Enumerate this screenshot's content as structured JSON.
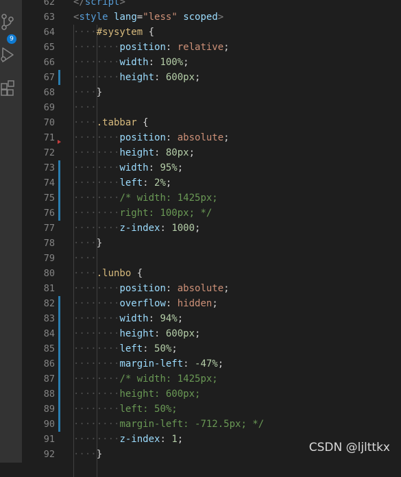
{
  "activity_bar": {
    "icons": [
      "source-control-icon",
      "run-debug-icon",
      "extensions-icon"
    ],
    "scm_badge": "9",
    "accent_color": "#0e7ad1"
  },
  "editor": {
    "lines": [
      {
        "num": "62",
        "indent": 0,
        "tokens": [
          {
            "t": "</",
            "c": "tag"
          },
          {
            "t": "script",
            "c": "tagname"
          },
          {
            "t": ">",
            "c": "tag"
          }
        ]
      },
      {
        "num": "63",
        "indent": 0,
        "tokens": [
          {
            "t": "<",
            "c": "tag"
          },
          {
            "t": "style",
            "c": "tagname"
          },
          {
            "t": " ",
            "c": "punc"
          },
          {
            "t": "lang",
            "c": "attr"
          },
          {
            "t": "=",
            "c": "punc"
          },
          {
            "t": "\"less\"",
            "c": "str"
          },
          {
            "t": " ",
            "c": "punc"
          },
          {
            "t": "scoped",
            "c": "attr"
          },
          {
            "t": ">",
            "c": "tag"
          }
        ]
      },
      {
        "num": "64",
        "indent": 4,
        "tokens": [
          {
            "t": "#sysytem",
            "c": "sel"
          },
          {
            "t": " {",
            "c": "punc"
          }
        ]
      },
      {
        "num": "65",
        "indent": 8,
        "tokens": [
          {
            "t": "position",
            "c": "prop"
          },
          {
            "t": ": ",
            "c": "punc"
          },
          {
            "t": "relative",
            "c": "val"
          },
          {
            "t": ";",
            "c": "punc"
          }
        ]
      },
      {
        "num": "66",
        "indent": 8,
        "tokens": [
          {
            "t": "width",
            "c": "prop"
          },
          {
            "t": ": ",
            "c": "punc"
          },
          {
            "t": "100%",
            "c": "num"
          },
          {
            "t": ";",
            "c": "punc"
          }
        ]
      },
      {
        "num": "67",
        "indent": 8,
        "tokens": [
          {
            "t": "height",
            "c": "prop"
          },
          {
            "t": ": ",
            "c": "punc"
          },
          {
            "t": "600px",
            "c": "num"
          },
          {
            "t": ";",
            "c": "punc"
          }
        ]
      },
      {
        "num": "68",
        "indent": 4,
        "tokens": [
          {
            "t": "}",
            "c": "punc"
          }
        ]
      },
      {
        "num": "69",
        "indent": 4,
        "tokens": []
      },
      {
        "num": "70",
        "indent": 4,
        "tokens": [
          {
            "t": ".tabbar",
            "c": "sel"
          },
          {
            "t": " {",
            "c": "punc"
          }
        ]
      },
      {
        "num": "71",
        "indent": 8,
        "tokens": [
          {
            "t": "position",
            "c": "prop"
          },
          {
            "t": ": ",
            "c": "punc"
          },
          {
            "t": "absolute",
            "c": "val"
          },
          {
            "t": ";",
            "c": "punc"
          }
        ]
      },
      {
        "num": "72",
        "indent": 8,
        "tokens": [
          {
            "t": "height",
            "c": "prop"
          },
          {
            "t": ": ",
            "c": "punc"
          },
          {
            "t": "80px",
            "c": "num"
          },
          {
            "t": ";",
            "c": "punc"
          }
        ]
      },
      {
        "num": "73",
        "indent": 8,
        "tokens": [
          {
            "t": "width",
            "c": "prop"
          },
          {
            "t": ": ",
            "c": "punc"
          },
          {
            "t": "95%",
            "c": "num"
          },
          {
            "t": ";",
            "c": "punc"
          }
        ]
      },
      {
        "num": "74",
        "indent": 8,
        "tokens": [
          {
            "t": "left",
            "c": "prop"
          },
          {
            "t": ": ",
            "c": "punc"
          },
          {
            "t": "2%",
            "c": "num"
          },
          {
            "t": ";",
            "c": "punc"
          }
        ]
      },
      {
        "num": "75",
        "indent": 8,
        "tokens": [
          {
            "t": "/* width: 1425px;",
            "c": "cmt"
          }
        ]
      },
      {
        "num": "76",
        "indent": 8,
        "tokens": [
          {
            "t": "right: 100px; */",
            "c": "cmt"
          }
        ]
      },
      {
        "num": "77",
        "indent": 8,
        "tokens": [
          {
            "t": "z-index",
            "c": "prop"
          },
          {
            "t": ": ",
            "c": "punc"
          },
          {
            "t": "1000",
            "c": "num"
          },
          {
            "t": ";",
            "c": "punc"
          }
        ]
      },
      {
        "num": "78",
        "indent": 4,
        "tokens": [
          {
            "t": "}",
            "c": "punc"
          }
        ]
      },
      {
        "num": "79",
        "indent": 4,
        "tokens": []
      },
      {
        "num": "80",
        "indent": 4,
        "tokens": [
          {
            "t": ".lunbo",
            "c": "sel"
          },
          {
            "t": " {",
            "c": "punc"
          }
        ]
      },
      {
        "num": "81",
        "indent": 8,
        "tokens": [
          {
            "t": "position",
            "c": "prop"
          },
          {
            "t": ": ",
            "c": "punc"
          },
          {
            "t": "absolute",
            "c": "val"
          },
          {
            "t": ";",
            "c": "punc"
          }
        ]
      },
      {
        "num": "82",
        "indent": 8,
        "tokens": [
          {
            "t": "overflow",
            "c": "prop"
          },
          {
            "t": ": ",
            "c": "punc"
          },
          {
            "t": "hidden",
            "c": "val"
          },
          {
            "t": ";",
            "c": "punc"
          }
        ]
      },
      {
        "num": "83",
        "indent": 8,
        "tokens": [
          {
            "t": "width",
            "c": "prop"
          },
          {
            "t": ": ",
            "c": "punc"
          },
          {
            "t": "94%",
            "c": "num"
          },
          {
            "t": ";",
            "c": "punc"
          }
        ]
      },
      {
        "num": "84",
        "indent": 8,
        "tokens": [
          {
            "t": "height",
            "c": "prop"
          },
          {
            "t": ": ",
            "c": "punc"
          },
          {
            "t": "600px",
            "c": "num"
          },
          {
            "t": ";",
            "c": "punc"
          }
        ]
      },
      {
        "num": "85",
        "indent": 8,
        "tokens": [
          {
            "t": "left",
            "c": "prop"
          },
          {
            "t": ": ",
            "c": "punc"
          },
          {
            "t": "50%",
            "c": "num"
          },
          {
            "t": ";",
            "c": "punc"
          }
        ]
      },
      {
        "num": "86",
        "indent": 8,
        "tokens": [
          {
            "t": "margin-left",
            "c": "prop"
          },
          {
            "t": ": ",
            "c": "punc"
          },
          {
            "t": "-47%",
            "c": "num"
          },
          {
            "t": ";",
            "c": "punc"
          }
        ]
      },
      {
        "num": "87",
        "indent": 8,
        "tokens": [
          {
            "t": "/* width: 1425px;",
            "c": "cmt"
          }
        ]
      },
      {
        "num": "88",
        "indent": 8,
        "tokens": [
          {
            "t": "height: 600px;",
            "c": "cmt"
          }
        ]
      },
      {
        "num": "89",
        "indent": 8,
        "tokens": [
          {
            "t": "left: 50%;",
            "c": "cmt"
          }
        ]
      },
      {
        "num": "90",
        "indent": 8,
        "tokens": [
          {
            "t": "margin-left: -712.5px; */",
            "c": "cmt"
          }
        ]
      },
      {
        "num": "91",
        "indent": 8,
        "tokens": [
          {
            "t": "z-index",
            "c": "prop"
          },
          {
            "t": ": ",
            "c": "punc"
          },
          {
            "t": "1",
            "c": "num"
          },
          {
            "t": ";",
            "c": "punc"
          }
        ]
      },
      {
        "num": "92",
        "indent": 4,
        "tokens": [
          {
            "t": "}",
            "c": "punc"
          }
        ]
      }
    ],
    "modified_line_numbers": [
      "67",
      "73",
      "74",
      "75",
      "76",
      "82",
      "83",
      "84",
      "85",
      "86",
      "87",
      "88",
      "89",
      "90"
    ],
    "deleted_marker_after_line": "72"
  },
  "watermark": "CSDN @ljlttkx"
}
